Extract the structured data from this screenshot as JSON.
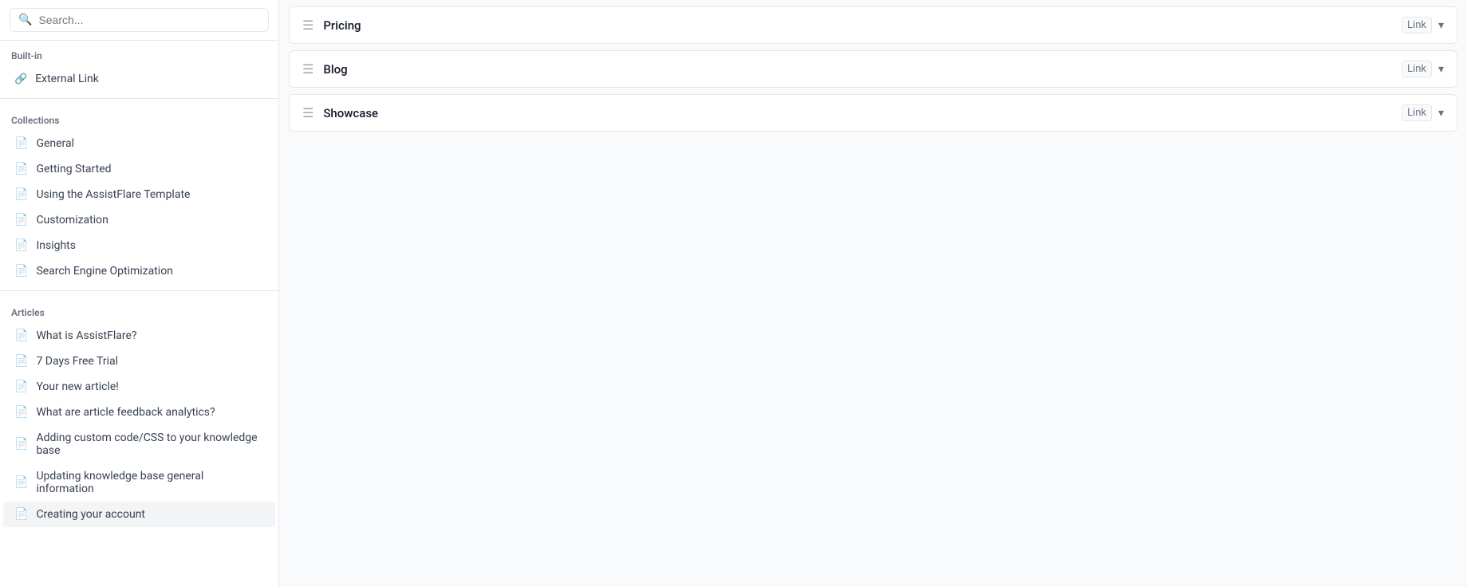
{
  "search": {
    "placeholder": "Search..."
  },
  "sidebar": {
    "builtin_label": "Built-in",
    "builtin_items": [
      {
        "label": "External Link",
        "icon": "external"
      }
    ],
    "collections_label": "Collections",
    "collections_items": [
      {
        "label": "General",
        "icon": "doc"
      },
      {
        "label": "Getting Started",
        "icon": "doc"
      },
      {
        "label": "Using the AssistFlare Template",
        "icon": "doc"
      },
      {
        "label": "Customization",
        "icon": "doc"
      },
      {
        "label": "Insights",
        "icon": "doc"
      },
      {
        "label": "Search Engine Optimization",
        "icon": "doc"
      }
    ],
    "articles_label": "Articles",
    "articles_items": [
      {
        "label": "What is AssistFlare?",
        "icon": "doc"
      },
      {
        "label": "7 Days Free Trial",
        "icon": "doc"
      },
      {
        "label": "Your new article!",
        "icon": "doc"
      },
      {
        "label": "What are article feedback analytics?",
        "icon": "doc"
      },
      {
        "label": "Adding custom code/CSS to your knowledge base",
        "icon": "doc"
      },
      {
        "label": "Updating knowledge base general information",
        "icon": "doc"
      },
      {
        "label": "Creating your account",
        "icon": "doc"
      }
    ]
  },
  "main": {
    "nav_items": [
      {
        "label": "Pricing",
        "badge": "Link"
      },
      {
        "label": "Blog",
        "badge": "Link"
      },
      {
        "label": "Showcase",
        "badge": "Link"
      }
    ]
  }
}
